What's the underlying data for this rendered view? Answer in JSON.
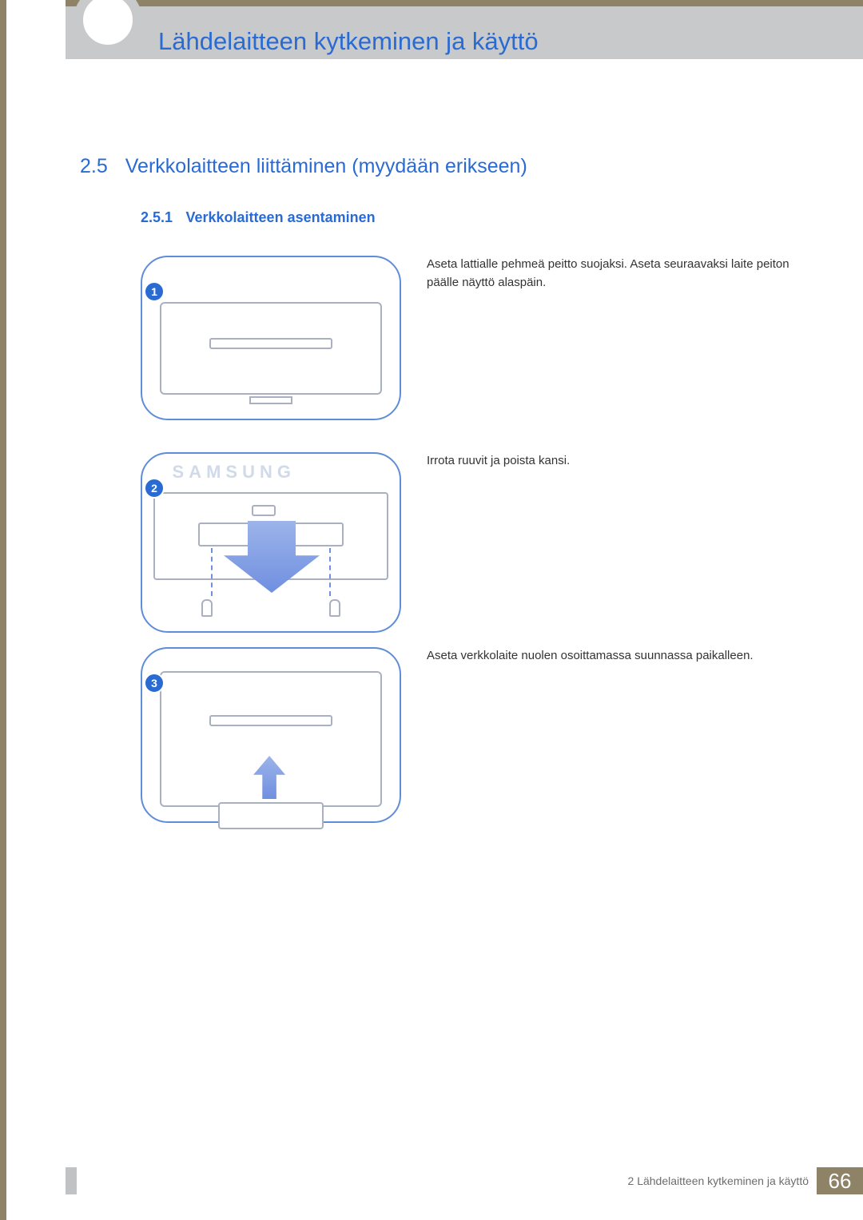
{
  "chapter_title": "Lähdelaitteen kytkeminen ja käyttö",
  "section": {
    "number": "2.5",
    "title": "Verkkolaitteen liittäminen (myydään erikseen)"
  },
  "subsection": {
    "number": "2.5.1",
    "title": "Verkkolaitteen asentaminen"
  },
  "steps": [
    {
      "badge": "1",
      "text": "Aseta lattialle pehmeä peitto suojaksi. Aseta seuraavaksi laite peiton päälle näyttö alaspäin."
    },
    {
      "badge": "2",
      "text": "Irrota ruuvit ja poista kansi."
    },
    {
      "badge": "3",
      "text": "Aseta verkkolaite nuolen osoittamassa suunnassa paikalleen."
    }
  ],
  "diagram_brand": "SAMSUNG",
  "footer": {
    "chapter_ref": "2 Lähdelaitteen kytkeminen ja käyttö",
    "page": "66"
  }
}
